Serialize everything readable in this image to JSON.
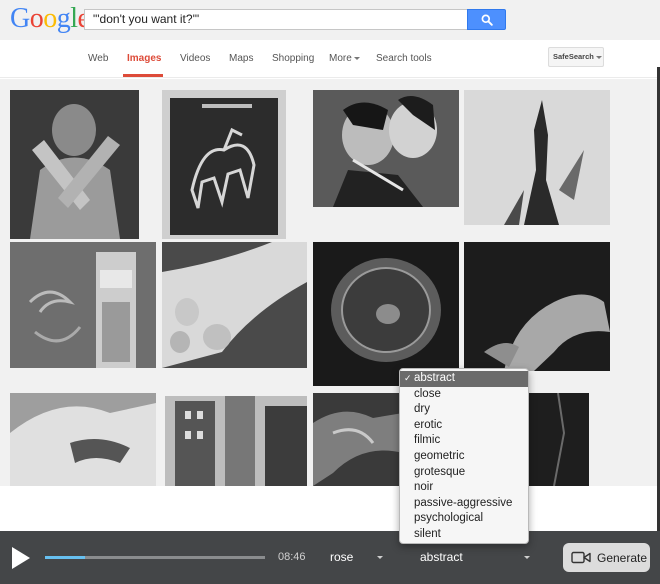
{
  "logo": [
    "G",
    "o",
    "o",
    "g",
    "l",
    "e"
  ],
  "logo_colors": [
    "#4285f4",
    "#ea4335",
    "#fbbc05",
    "#4285f4",
    "#34a853",
    "#ea4335"
  ],
  "search": {
    "query": "\"'don't you want it?'\"",
    "button_icon": "search-icon"
  },
  "nav": {
    "web": "Web",
    "images": "Images",
    "videos": "Videos",
    "maps": "Maps",
    "shopping": "Shopping",
    "more": "More",
    "search_tools": "Search tools",
    "safesearch": "SafeSearch",
    "active": "Images"
  },
  "player": {
    "time": "08:46",
    "progress": 0.18,
    "select1": "rose",
    "select2": "abstract",
    "generate_label": "Generate",
    "generate_icon": "video-camera-icon",
    "play_icon": "play-icon"
  },
  "dropdown": {
    "selected": "abstract",
    "options": [
      "abstract",
      "close",
      "dry",
      "erotic",
      "filmic",
      "geometric",
      "grotesque",
      "noir",
      "passive-aggressive",
      "psychological",
      "silent"
    ]
  },
  "colors": {
    "accent_red": "#dd4b39",
    "search_blue": "#4d90fe",
    "progress_blue": "#67c0f0",
    "player_bg": "#444648"
  }
}
